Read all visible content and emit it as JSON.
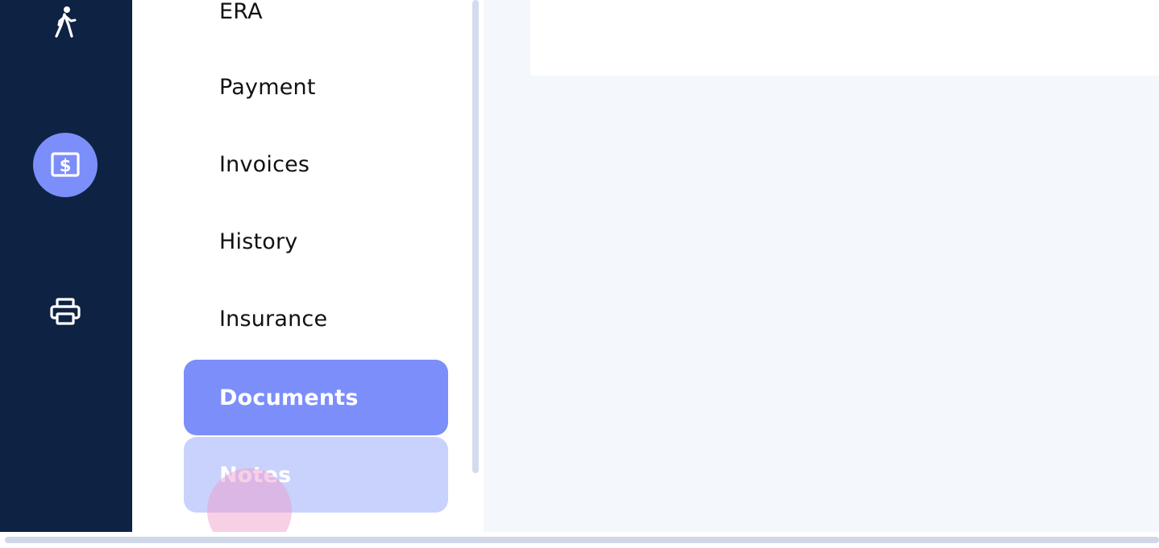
{
  "rail": {
    "items": [
      {
        "icon": "walking-person-icon",
        "active": false
      },
      {
        "icon": "billing-dollar-icon",
        "active": true
      },
      {
        "icon": "printer-icon",
        "active": false
      }
    ],
    "colors": {
      "background": "#0e2243",
      "active": "#7b8efa"
    }
  },
  "submenu": {
    "items": [
      {
        "label": "ERA",
        "state": "normal"
      },
      {
        "label": "Payment",
        "state": "normal"
      },
      {
        "label": "Invoices",
        "state": "normal"
      },
      {
        "label": "History",
        "state": "normal"
      },
      {
        "label": "Insurance",
        "state": "normal"
      },
      {
        "label": "Documents",
        "state": "active"
      },
      {
        "label": "Notes",
        "state": "hover"
      }
    ],
    "colors": {
      "active": "#7b8efa",
      "hover": "#c9d1fd"
    }
  },
  "content": {
    "background": "#f4f7fc"
  }
}
